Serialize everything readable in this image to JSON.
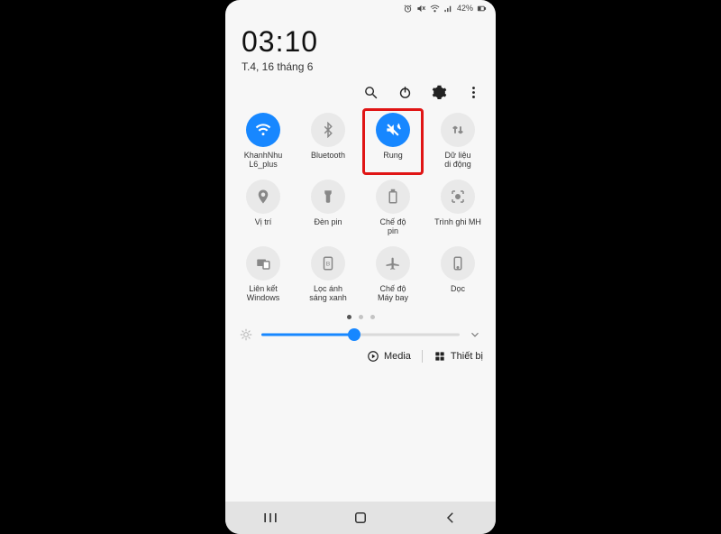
{
  "status": {
    "battery": "42%"
  },
  "clock": "03:10",
  "date": "T.4, 16 tháng 6",
  "tiles": [
    {
      "label": "KhanhNhu\nL6_plus",
      "icon": "wifi",
      "active": true,
      "highlight": false
    },
    {
      "label": "Bluetooth",
      "icon": "bluetooth",
      "active": false,
      "highlight": false
    },
    {
      "label": "Rung",
      "icon": "vibrate",
      "active": true,
      "highlight": true
    },
    {
      "label": "Dữ liệu\ndi động",
      "icon": "data",
      "active": false,
      "highlight": false
    },
    {
      "label": "Vị trí",
      "icon": "location",
      "active": false,
      "highlight": false
    },
    {
      "label": "Đèn pin",
      "icon": "flashlight",
      "active": false,
      "highlight": false
    },
    {
      "label": "Chế độ\npin",
      "icon": "battery",
      "active": false,
      "highlight": false
    },
    {
      "label": "Trình ghi MH",
      "icon": "record",
      "active": false,
      "highlight": false
    },
    {
      "label": "Liên kết\nWindows",
      "icon": "link",
      "active": false,
      "highlight": false
    },
    {
      "label": "Lọc ánh\nsáng xanh",
      "icon": "bluelight",
      "active": false,
      "highlight": false
    },
    {
      "label": "Chế độ\nMáy bay",
      "icon": "airplane",
      "active": false,
      "highlight": false
    },
    {
      "label": "Dọc",
      "icon": "portrait",
      "active": false,
      "highlight": false
    }
  ],
  "brightness_pct": 47,
  "footer": {
    "media": "Media",
    "devices": "Thiết bị"
  },
  "pager": {
    "count": 3,
    "active": 0
  }
}
